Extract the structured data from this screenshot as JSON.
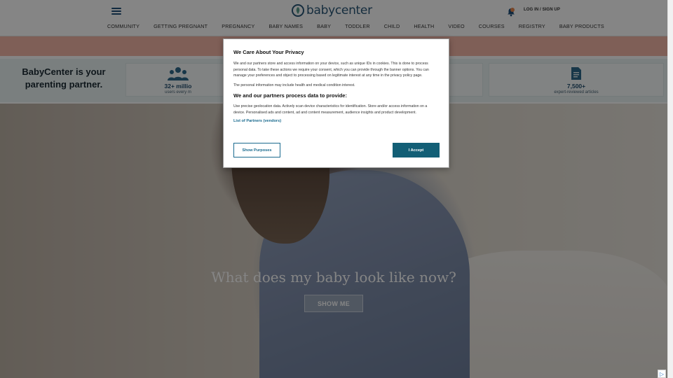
{
  "header": {
    "logo_text": "babycenter",
    "login_label": "LOG IN / SIGN UP"
  },
  "nav": {
    "items": [
      "COMMUNITY",
      "GETTING PREGNANT",
      "PREGNANCY",
      "BABY NAMES",
      "BABY",
      "TODDLER",
      "CHILD",
      "HEALTH",
      "VIDEO",
      "COURSES",
      "REGISTRY",
      "BABY PRODUCTS"
    ]
  },
  "stats": {
    "title": "BabyCenter is your parenting partner.",
    "cards": [
      {
        "value": "32+ millio",
        "label": "users every m"
      },
      {
        "value": "7,500+",
        "label": "expert-reviewed articles"
      }
    ]
  },
  "hero": {
    "title": "What does my baby look like now?",
    "button_label": "SHOW ME"
  },
  "consent": {
    "title": "We Care About Your Privacy",
    "paragraph1": "We and our partners store and access information on your device, such as unique IDs in cookies. This is done to process personal data. To take these actions we require your consent, which you can provide through the banner options. You can manage your preferences and object to processing based on legitimate interest at any time in the privacy policy page.",
    "paragraph2": "The personal information may include health and medical condition interest.",
    "subtitle": "We and our partners process data to provide:",
    "paragraph3": "Use precise geolocation data. Actively scan device characteristics for identification. Store and/or access information on a device. Personalised ads and content, ad and content measurement, audience insights and product development.",
    "partners_link": "List of Partners (vendors)",
    "show_purposes_label": "Show Purposes",
    "accept_label": "I Accept"
  },
  "colors": {
    "brand_blue": "#2a5777",
    "accept_teal": "#135f76",
    "promo_salmon": "#f3b6a8",
    "stats_bg": "#eaf3f3"
  },
  "icons": {
    "menu": "hamburger-menu-icon",
    "notification": "bell-icon",
    "users": "users-group-icon",
    "articles": "document-icon",
    "ad_choices": "ad-choices-icon"
  }
}
